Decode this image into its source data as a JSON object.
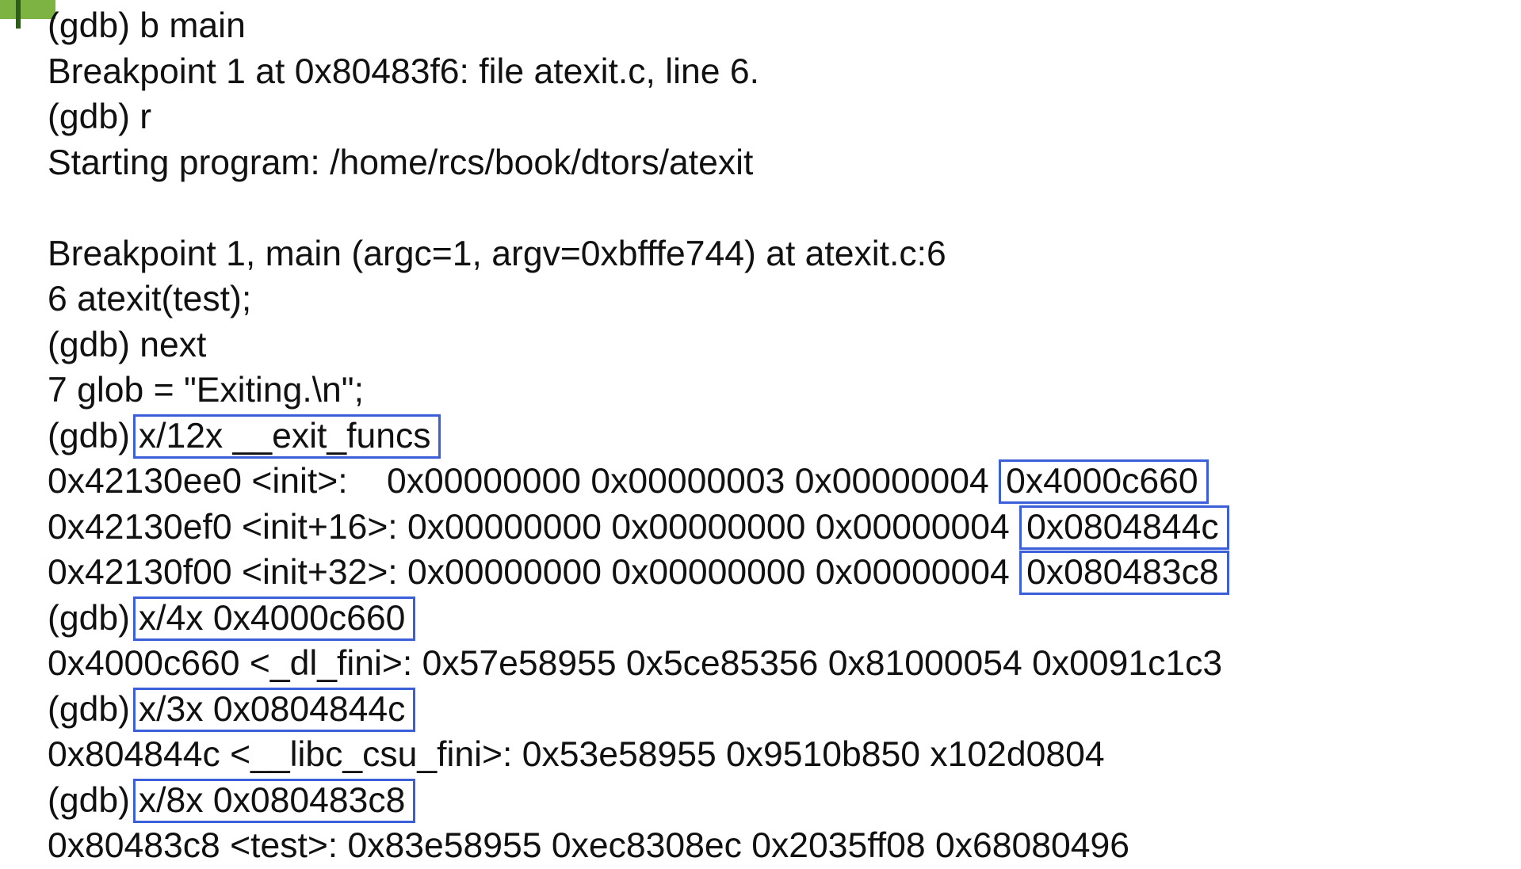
{
  "terminal": {
    "lines": [
      "(gdb) b main",
      "Breakpoint 1 at 0x80483f6: file atexit.c, line 6.",
      "(gdb) r",
      "Starting program: /home/rcs/book/dtors/atexit",
      "",
      "Breakpoint 1, main (argc=1, argv=0xbfffe744) at atexit.c:6",
      "6 atexit(test);",
      "(gdb) next",
      "7 glob = \"Exiting.\\n\";",
      {
        "prefix": "(gdb)",
        "cmd": "x/12x __exit_funcs"
      },
      {
        "text": "0x42130ee0 <init>:    0x00000000 0x00000003 0x00000004 ",
        "box": "0x4000c660"
      },
      {
        "text": "0x42130ef0 <init+16>: 0x00000000 0x00000000 0x00000004 ",
        "box": "0x0804844c"
      },
      {
        "text": "0x42130f00 <init+32>: 0x00000000 0x00000000 0x00000004 ",
        "box": "0x080483c8"
      },
      {
        "prefix": "(gdb)",
        "cmd": "x/4x 0x4000c660"
      },
      "0x4000c660 <_dl_fini>: 0x57e58955 0x5ce85356 0x81000054 0x0091c1c3",
      {
        "prefix": "(gdb)",
        "cmd": "x/3x 0x0804844c"
      },
      "0x804844c <__libc_csu_fini>: 0x53e58955 0x9510b850 x102d0804",
      {
        "prefix": "(gdb)",
        "cmd": "x/8x 0x080483c8"
      },
      "0x80483c8 <test>: 0x83e58955 0xec8308ec 0x2035ff08 0x68080496"
    ]
  },
  "colors": {
    "highlight_box": "#3a5fd9",
    "corner_accent": "#7cb342"
  }
}
